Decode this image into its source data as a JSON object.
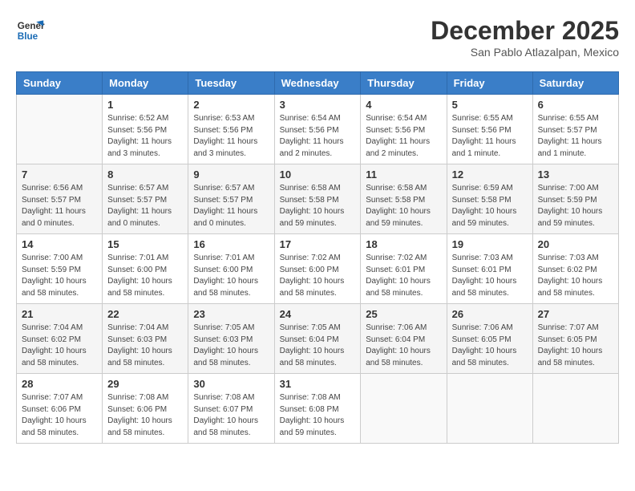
{
  "header": {
    "logo_line1": "General",
    "logo_line2": "Blue",
    "month_title": "December 2025",
    "location": "San Pablo Atlazalpan, Mexico"
  },
  "weekdays": [
    "Sunday",
    "Monday",
    "Tuesday",
    "Wednesday",
    "Thursday",
    "Friday",
    "Saturday"
  ],
  "weeks": [
    [
      {
        "day": "",
        "info": ""
      },
      {
        "day": "1",
        "info": "Sunrise: 6:52 AM\nSunset: 5:56 PM\nDaylight: 11 hours\nand 3 minutes."
      },
      {
        "day": "2",
        "info": "Sunrise: 6:53 AM\nSunset: 5:56 PM\nDaylight: 11 hours\nand 3 minutes."
      },
      {
        "day": "3",
        "info": "Sunrise: 6:54 AM\nSunset: 5:56 PM\nDaylight: 11 hours\nand 2 minutes."
      },
      {
        "day": "4",
        "info": "Sunrise: 6:54 AM\nSunset: 5:56 PM\nDaylight: 11 hours\nand 2 minutes."
      },
      {
        "day": "5",
        "info": "Sunrise: 6:55 AM\nSunset: 5:56 PM\nDaylight: 11 hours\nand 1 minute."
      },
      {
        "day": "6",
        "info": "Sunrise: 6:55 AM\nSunset: 5:57 PM\nDaylight: 11 hours\nand 1 minute."
      }
    ],
    [
      {
        "day": "7",
        "info": "Sunrise: 6:56 AM\nSunset: 5:57 PM\nDaylight: 11 hours\nand 0 minutes."
      },
      {
        "day": "8",
        "info": "Sunrise: 6:57 AM\nSunset: 5:57 PM\nDaylight: 11 hours\nand 0 minutes."
      },
      {
        "day": "9",
        "info": "Sunrise: 6:57 AM\nSunset: 5:57 PM\nDaylight: 11 hours\nand 0 minutes."
      },
      {
        "day": "10",
        "info": "Sunrise: 6:58 AM\nSunset: 5:58 PM\nDaylight: 10 hours\nand 59 minutes."
      },
      {
        "day": "11",
        "info": "Sunrise: 6:58 AM\nSunset: 5:58 PM\nDaylight: 10 hours\nand 59 minutes."
      },
      {
        "day": "12",
        "info": "Sunrise: 6:59 AM\nSunset: 5:58 PM\nDaylight: 10 hours\nand 59 minutes."
      },
      {
        "day": "13",
        "info": "Sunrise: 7:00 AM\nSunset: 5:59 PM\nDaylight: 10 hours\nand 59 minutes."
      }
    ],
    [
      {
        "day": "14",
        "info": "Sunrise: 7:00 AM\nSunset: 5:59 PM\nDaylight: 10 hours\nand 58 minutes."
      },
      {
        "day": "15",
        "info": "Sunrise: 7:01 AM\nSunset: 6:00 PM\nDaylight: 10 hours\nand 58 minutes."
      },
      {
        "day": "16",
        "info": "Sunrise: 7:01 AM\nSunset: 6:00 PM\nDaylight: 10 hours\nand 58 minutes."
      },
      {
        "day": "17",
        "info": "Sunrise: 7:02 AM\nSunset: 6:00 PM\nDaylight: 10 hours\nand 58 minutes."
      },
      {
        "day": "18",
        "info": "Sunrise: 7:02 AM\nSunset: 6:01 PM\nDaylight: 10 hours\nand 58 minutes."
      },
      {
        "day": "19",
        "info": "Sunrise: 7:03 AM\nSunset: 6:01 PM\nDaylight: 10 hours\nand 58 minutes."
      },
      {
        "day": "20",
        "info": "Sunrise: 7:03 AM\nSunset: 6:02 PM\nDaylight: 10 hours\nand 58 minutes."
      }
    ],
    [
      {
        "day": "21",
        "info": "Sunrise: 7:04 AM\nSunset: 6:02 PM\nDaylight: 10 hours\nand 58 minutes."
      },
      {
        "day": "22",
        "info": "Sunrise: 7:04 AM\nSunset: 6:03 PM\nDaylight: 10 hours\nand 58 minutes."
      },
      {
        "day": "23",
        "info": "Sunrise: 7:05 AM\nSunset: 6:03 PM\nDaylight: 10 hours\nand 58 minutes."
      },
      {
        "day": "24",
        "info": "Sunrise: 7:05 AM\nSunset: 6:04 PM\nDaylight: 10 hours\nand 58 minutes."
      },
      {
        "day": "25",
        "info": "Sunrise: 7:06 AM\nSunset: 6:04 PM\nDaylight: 10 hours\nand 58 minutes."
      },
      {
        "day": "26",
        "info": "Sunrise: 7:06 AM\nSunset: 6:05 PM\nDaylight: 10 hours\nand 58 minutes."
      },
      {
        "day": "27",
        "info": "Sunrise: 7:07 AM\nSunset: 6:05 PM\nDaylight: 10 hours\nand 58 minutes."
      }
    ],
    [
      {
        "day": "28",
        "info": "Sunrise: 7:07 AM\nSunset: 6:06 PM\nDaylight: 10 hours\nand 58 minutes."
      },
      {
        "day": "29",
        "info": "Sunrise: 7:08 AM\nSunset: 6:06 PM\nDaylight: 10 hours\nand 58 minutes."
      },
      {
        "day": "30",
        "info": "Sunrise: 7:08 AM\nSunset: 6:07 PM\nDaylight: 10 hours\nand 58 minutes."
      },
      {
        "day": "31",
        "info": "Sunrise: 7:08 AM\nSunset: 6:08 PM\nDaylight: 10 hours\nand 59 minutes."
      },
      {
        "day": "",
        "info": ""
      },
      {
        "day": "",
        "info": ""
      },
      {
        "day": "",
        "info": ""
      }
    ]
  ]
}
